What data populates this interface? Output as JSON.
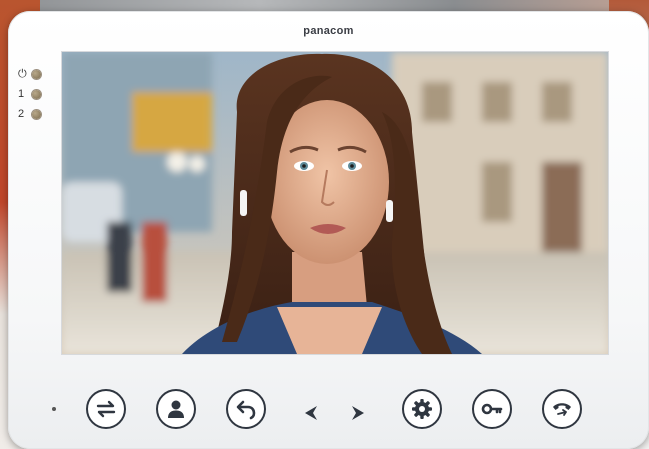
{
  "device": {
    "brand": "panacom",
    "leds": [
      {
        "label": "⏻",
        "icon": "power-icon"
      },
      {
        "label": "1",
        "icon": "led-1-indicator"
      },
      {
        "label": "2",
        "icon": "led-2-indicator"
      }
    ]
  },
  "controls": {
    "buttons": [
      {
        "name": "transfer-button",
        "icon": "swap-arrows-icon"
      },
      {
        "name": "contact-button",
        "icon": "person-icon"
      },
      {
        "name": "back-button",
        "icon": "return-arrow-icon"
      },
      {
        "name": "previous-button",
        "icon": "chevron-left-icon"
      },
      {
        "name": "next-button",
        "icon": "chevron-right-icon"
      },
      {
        "name": "settings-button",
        "icon": "gear-icon"
      },
      {
        "name": "unlock-button",
        "icon": "key-icon"
      },
      {
        "name": "hangup-button",
        "icon": "phone-icon"
      }
    ]
  },
  "colors": {
    "body": "#ffffff",
    "button_stroke": "#2f3640",
    "led": "#8d7d5e"
  }
}
